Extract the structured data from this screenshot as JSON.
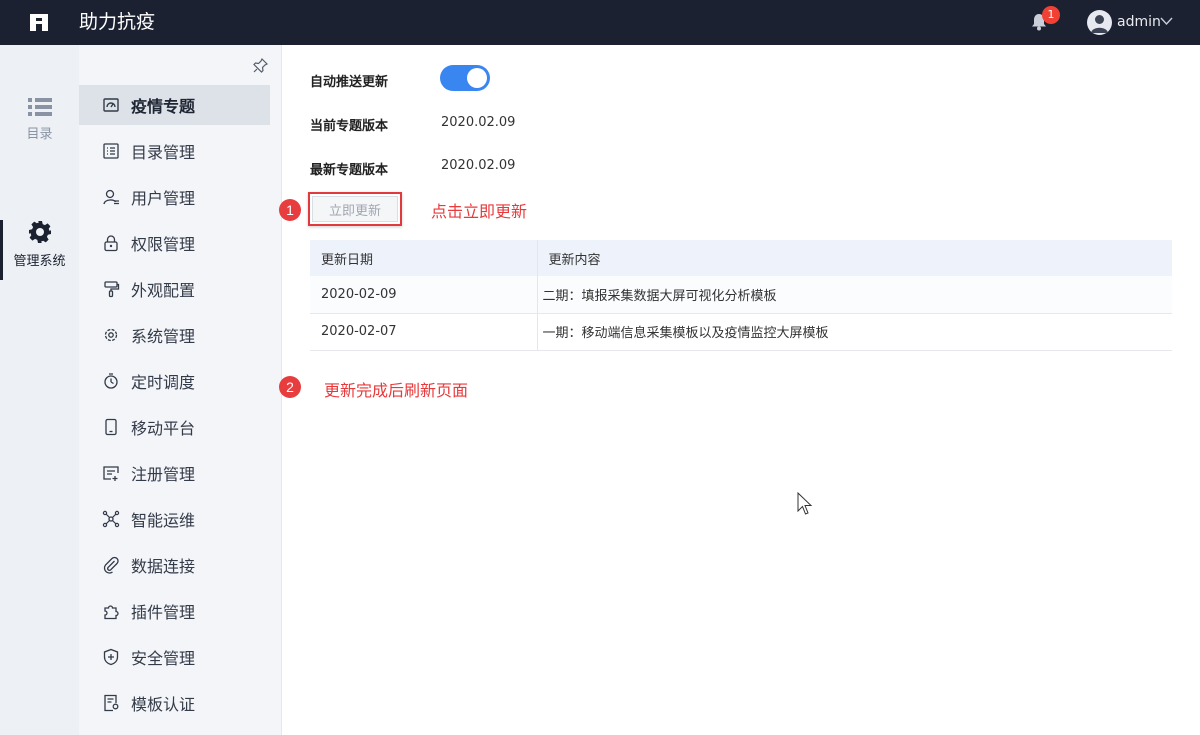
{
  "header": {
    "app_title": "助力抗疫",
    "notification_count": "1",
    "user_name": "admin"
  },
  "rail": {
    "items": [
      {
        "label": "目录",
        "icon": "list-icon",
        "active": false
      },
      {
        "label": "管理系统",
        "icon": "gear-icon",
        "active": true
      }
    ]
  },
  "menu": {
    "items": [
      {
        "label": "疫情专题",
        "icon": "dashboard-icon",
        "active": true
      },
      {
        "label": "目录管理",
        "icon": "catalog-icon"
      },
      {
        "label": "用户管理",
        "icon": "user-icon"
      },
      {
        "label": "权限管理",
        "icon": "lock-icon"
      },
      {
        "label": "外观配置",
        "icon": "brush-icon"
      },
      {
        "label": "系统管理",
        "icon": "gear-icon"
      },
      {
        "label": "定时调度",
        "icon": "timer-icon"
      },
      {
        "label": "移动平台",
        "icon": "tablet-icon"
      },
      {
        "label": "注册管理",
        "icon": "register-icon"
      },
      {
        "label": "智能运维",
        "icon": "network-icon"
      },
      {
        "label": "数据连接",
        "icon": "paperclip-icon"
      },
      {
        "label": "插件管理",
        "icon": "puzzle-icon"
      },
      {
        "label": "安全管理",
        "icon": "shield-icon"
      },
      {
        "label": "模板认证",
        "icon": "certificate-icon"
      }
    ]
  },
  "settings": {
    "auto_push_label": "自动推送更新",
    "auto_push_enabled": true,
    "current_version_label": "当前专题版本",
    "current_version": "2020.02.09",
    "latest_version_label": "最新专题版本",
    "latest_version": "2020.02.09",
    "update_button": "立即更新"
  },
  "annotations": {
    "step1_number": "1",
    "step1_text": "点击立即更新",
    "step2_number": "2",
    "step2_text": "更新完成后刷新页面",
    "color": "#e8393b"
  },
  "update_log": {
    "columns": [
      "更新日期",
      "更新内容"
    ],
    "rows": [
      {
        "date": "2020-02-09",
        "content": "二期：填报采集数据大屏可视化分析模板"
      },
      {
        "date": "2020-02-07",
        "content": "一期：移动端信息采集模板以及疫情监控大屏模板"
      }
    ]
  },
  "colors": {
    "topbar": "#1b2130",
    "toggle_on": "#3a86f0",
    "badge": "#f04134"
  }
}
